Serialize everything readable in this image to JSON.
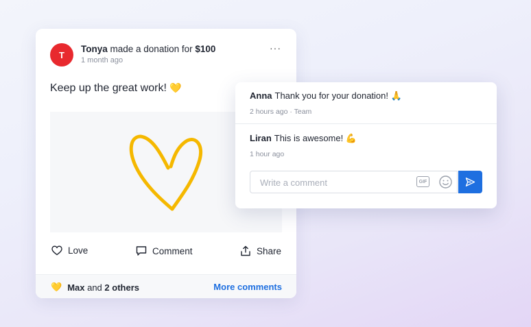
{
  "post": {
    "avatar_initial": "T",
    "author": "Tonya",
    "action_text": " made a donation for ",
    "amount": "$100",
    "time": "1 month ago",
    "more": "···",
    "text": "Keep up the great work! ",
    "text_emoji": "💛",
    "actions": {
      "love": "Love",
      "comment": "Comment",
      "share": "Share"
    },
    "reaction_emoji": "💛",
    "reaction_name": "Max",
    "reaction_and": " and ",
    "reaction_others": "2 others",
    "more_comments": "More comments"
  },
  "comments": [
    {
      "author": "Anna",
      "text": "Thank you for your donation! 🙏",
      "meta": "2 hours ago · Team"
    },
    {
      "author": "Liran",
      "text": "This is awesome! 💪",
      "meta": "1 hour ago"
    }
  ],
  "composer": {
    "placeholder": "Write a comment",
    "gif_label": "GIF"
  },
  "colors": {
    "avatar": "#e8292e",
    "accent": "#1e6fe0",
    "heart": "#f5b800"
  }
}
